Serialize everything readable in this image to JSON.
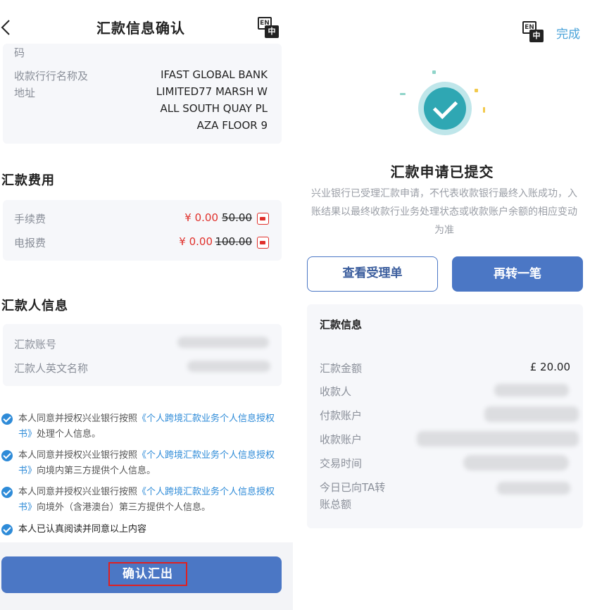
{
  "left": {
    "title": "汇款信息确认",
    "lang_en": "EN",
    "lang_zh": "中",
    "bank_top_fragment": "码",
    "bank_label_line1": "收款行行名称及",
    "bank_label_line2": "地址",
    "bank_value_lines": [
      "IFAST GLOBAL BANK",
      "LIMITED77 MARSH W",
      "ALL SOUTH QUAY PL",
      "AZA FLOOR 9"
    ],
    "fees_title": "汇款费用",
    "fees": [
      {
        "label": "手续费",
        "amount": "¥ 0.00",
        "original": "50.00"
      },
      {
        "label": "电报费",
        "amount": "¥ 0.00",
        "original": "100.00"
      }
    ],
    "remitter_title": "汇款人信息",
    "remitter_fields": [
      {
        "label": "汇款账号"
      },
      {
        "label": "汇款人英文名称"
      }
    ],
    "consents": [
      {
        "pre": "本人同意并授权兴业银行按照",
        "link": "《个人跨境汇款业务个人信息授权书》",
        "post": "处理个人信息。"
      },
      {
        "pre": "本人同意并授权兴业银行按照",
        "link": "《个人跨境汇款业务个人信息授权书》",
        "post": "向境内第三方提供个人信息。"
      },
      {
        "pre": "本人同意并授权兴业银行按照",
        "link": "《个人跨境汇款业务个人信息授权书》",
        "post": "向境外（含港澳台）第三方提供个人信息。"
      }
    ],
    "final_consent": "本人已认真阅读并同意以上内容",
    "confirm_button": "确认汇出"
  },
  "right": {
    "lang_en": "EN",
    "lang_zh": "中",
    "done": "完成",
    "success_title": "汇款申请已提交",
    "notice": "兴业银行已受理汇款申请，不代表收款银行最终入账成功，入账结果以最终收款行业务处理状态或收款账户余额的相应变动为准",
    "view_receipt_button": "查看受理单",
    "transfer_again_button": "再转一笔",
    "info_title": "汇款信息",
    "info_rows": [
      {
        "label": "汇款金额",
        "value": "£ 20.00"
      },
      {
        "label": "收款人",
        "value": ""
      },
      {
        "label": "付款账户",
        "value": ""
      },
      {
        "label": "收款账户",
        "value": ""
      },
      {
        "label": "交易时间",
        "value": ""
      }
    ],
    "ta_label_line1": "今日已向TA转",
    "ta_label_line2": "账总额"
  },
  "colors": {
    "primary": "#4b77c5",
    "link": "#2e8bd8",
    "discount_red": "#e0302b",
    "success_teal": "#2fa7b3"
  }
}
